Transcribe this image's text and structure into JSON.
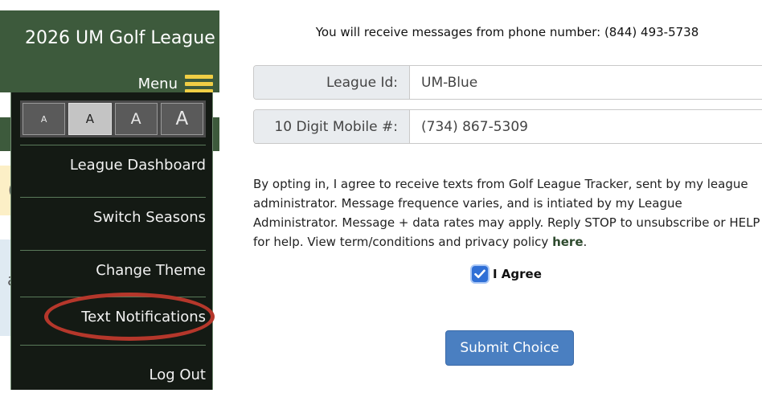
{
  "header": {
    "title": "2026 UM Golf League",
    "menu_label": "Menu"
  },
  "menu": {
    "font_sizes": [
      "A",
      "A",
      "A",
      "A"
    ],
    "active_font_size_index": 1,
    "items": [
      {
        "label": "League Dashboard"
      },
      {
        "label": "Switch Seasons"
      },
      {
        "label": "Change Theme"
      },
      {
        "label": "Text Notifications",
        "highlighted": true
      },
      {
        "label": "Log Out"
      }
    ]
  },
  "background_peek": {
    "yellow_char": "(",
    "blue_char": "a"
  },
  "form": {
    "notice": "You will receive messages from phone number: (844) 493-5738",
    "league_id_label": "League Id:",
    "league_id_value": "UM-Blue",
    "mobile_label": "10 Digit Mobile #:",
    "mobile_value": "(734) 867-5309",
    "consent_text": "By opting in, I agree to receive texts from Golf League Tracker, sent by my league administrator. Message frequence varies, and is intiated by my League Administrator. Message + data rates may apply. Reply STOP to unsubscribe or HELP for help. View term/conditions and privacy policy ",
    "consent_link": "here",
    "consent_end": ".",
    "agree_label": "I Agree",
    "agree_checked": true,
    "submit_label": "Submit Choice"
  },
  "colors": {
    "header_green": "#3d5a3c",
    "menu_bg": "#141a14",
    "hamburger": "#f0ce45",
    "highlight_ring": "#b5372b",
    "submit_blue": "#4a7fc1",
    "checkbox_blue": "#2f6fd6"
  }
}
